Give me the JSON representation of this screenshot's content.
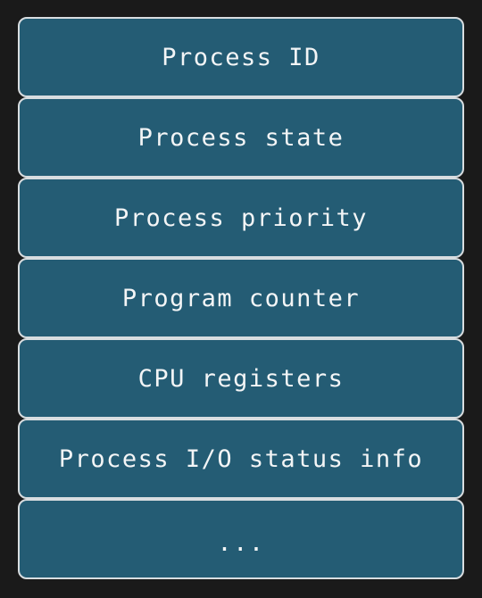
{
  "diagram": {
    "fields": [
      "Process ID",
      "Process state",
      "Process priority",
      "Program counter",
      "CPU registers",
      "Process I/O status info",
      "..."
    ]
  }
}
